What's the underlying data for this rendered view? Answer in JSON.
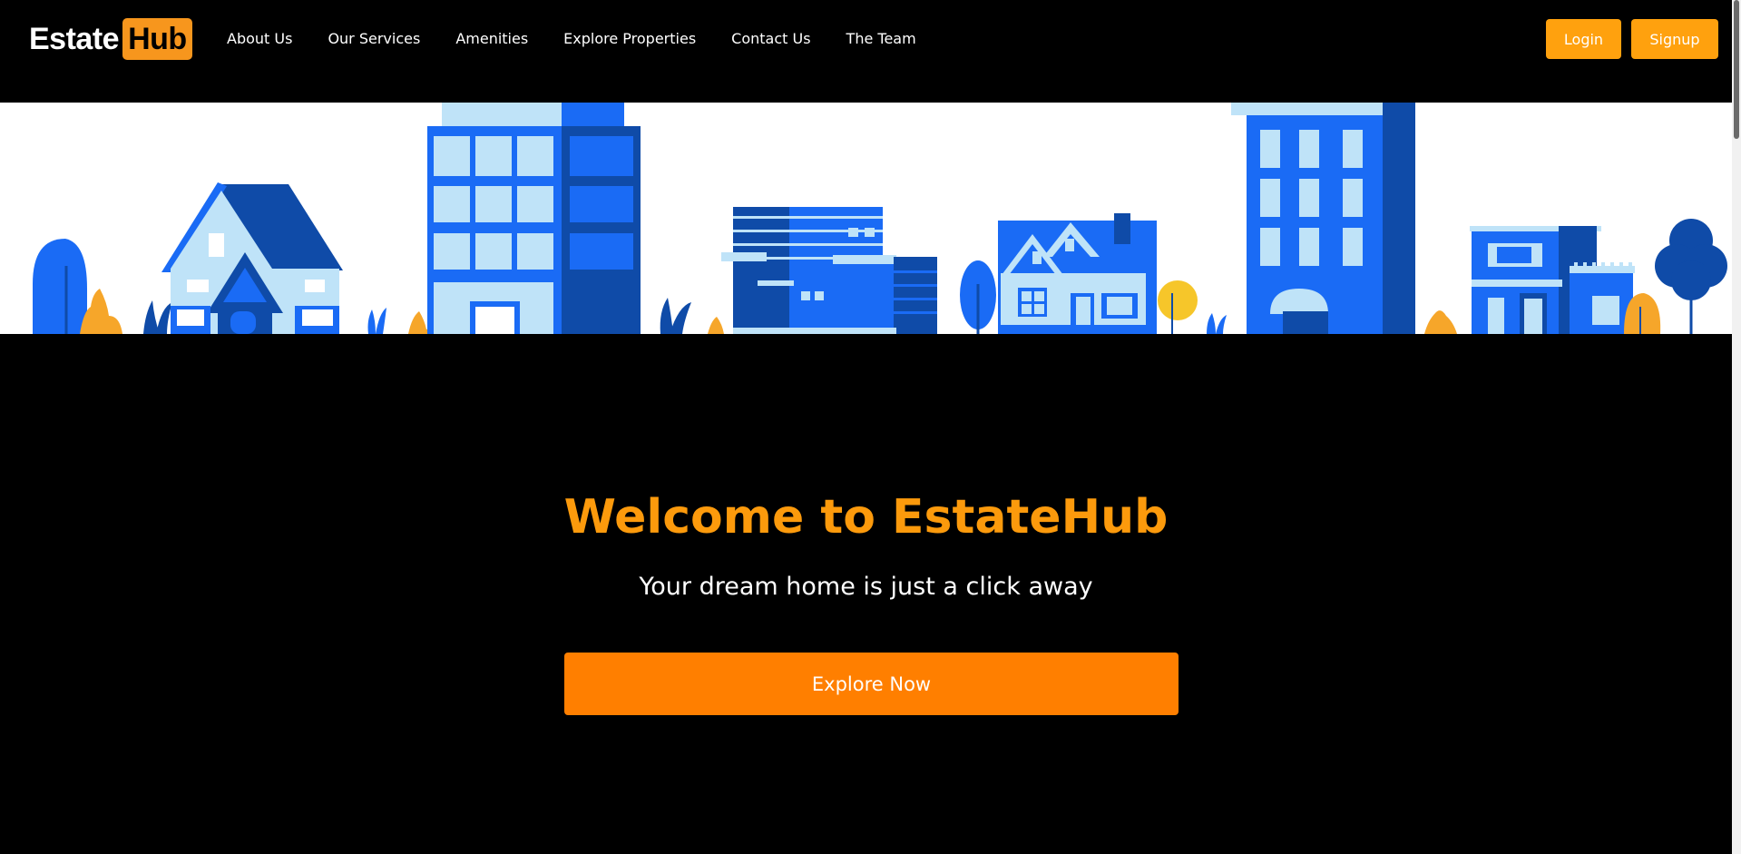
{
  "brand": {
    "logo_text": "Estate",
    "logo_highlight": "Hub"
  },
  "nav": {
    "links": [
      "About Us",
      "Our Services",
      "Amenities",
      "Explore Properties",
      "Contact Us",
      "The Team"
    ]
  },
  "auth": {
    "login_label": "Login",
    "signup_label": "Signup"
  },
  "hero": {
    "title": "Welcome to EstateHub",
    "subtitle": "Your dream home is just a click away",
    "cta_label": "Explore Now"
  },
  "colors": {
    "background": "#000000",
    "accent": "#ffa10e",
    "title": "#fc9a0c",
    "cta": "#ff7f00",
    "illustration_blue": "#1a6bf5",
    "illustration_dark_blue": "#0f4ba8",
    "illustration_light_blue": "#bfe3f8",
    "illustration_orange": "#f6a62a"
  }
}
